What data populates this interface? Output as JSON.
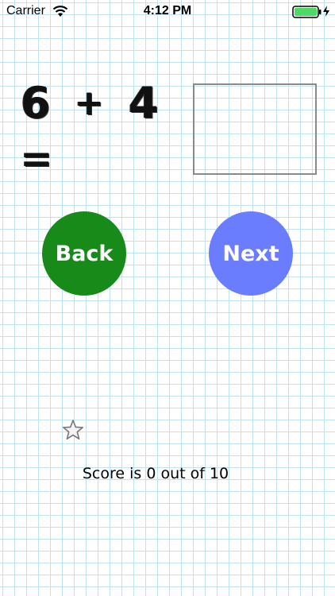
{
  "status_bar": {
    "carrier": "Carrier",
    "time": "4:12 PM",
    "wifi_icon": "wifi-icon",
    "battery_icon": "battery-icon",
    "charging_icon": "bolt-icon",
    "battery_color": "#4cd964"
  },
  "equation": {
    "operand_a": "6",
    "operator": "+",
    "operand_b": "4",
    "equals": "="
  },
  "answer_box": {
    "value": ""
  },
  "buttons": {
    "back_label": "Back",
    "back_color": "#178a1a",
    "next_label": "Next",
    "next_color": "#6b7dff"
  },
  "star_icon": "star-outline-icon",
  "score": {
    "text": "Score is 0 out of 10"
  }
}
